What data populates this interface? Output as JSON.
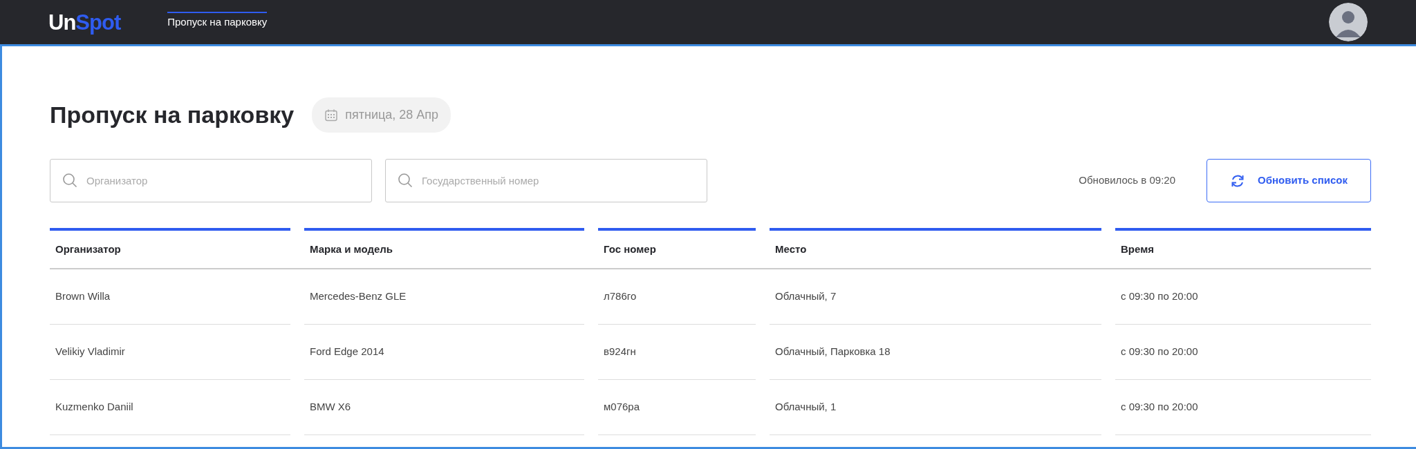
{
  "navbar": {
    "logo": [
      "Un",
      "Spot"
    ],
    "tabs": [
      {
        "label": "Пропуск на парковку",
        "selected": true
      }
    ]
  },
  "page": {
    "title": "Пропуск на парковку",
    "date": "пятница, 28 Апр"
  },
  "filters": [
    {
      "placeholder": "Организатор"
    },
    {
      "placeholder": "Государственный номер"
    }
  ],
  "updated": "Обновилось в 09:20",
  "refresh_button": "Обновить список",
  "table": {
    "columns": [
      "Организатор",
      "Марка и модель",
      "Гос номер",
      "Место",
      "Время"
    ],
    "rows": [
      [
        "Brown Willa",
        "Mercedes-Benz GLE",
        "л786го",
        "Облачный, 7",
        "с 09:30 по 20:00"
      ],
      [
        "Velikiy Vladimir",
        "Ford Edge 2014",
        "в924гн",
        "Облачный, Парковка 18",
        "с 09:30 по 20:00"
      ],
      [
        "Kuzmenko Daniil",
        "BMW X6",
        "м076ра",
        "Облачный, 1",
        "с 09:30 по 20:00"
      ]
    ]
  }
}
